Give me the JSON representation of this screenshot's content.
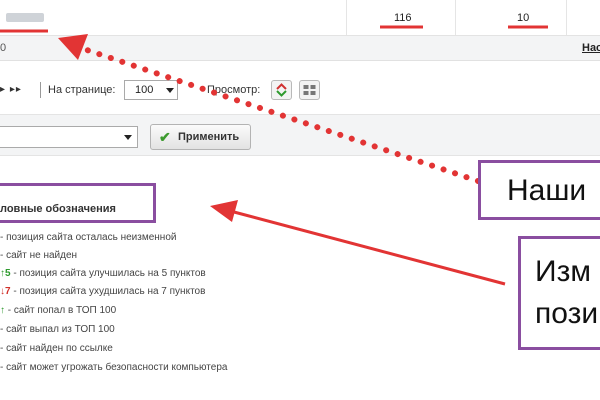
{
  "stats": {
    "value_1": "116",
    "value_2": "10"
  },
  "row2": {
    "left_fragment": "0",
    "settings_fragment": "Нас"
  },
  "toolbar": {
    "per_page_label": "На странице:",
    "per_page_value": "100",
    "view_label": "Просмотр:"
  },
  "filter": {
    "apply_label": "Применить"
  },
  "legend": {
    "title": "ловные обозначения",
    "items": [
      {
        "symbol": "",
        "text": "- позиция сайта осталась неизменной"
      },
      {
        "symbol": "",
        "text": "- сайт не найден"
      },
      {
        "symbol": "↑5",
        "text": " - позиция сайта улучшилась на 5 пунктов"
      },
      {
        "symbol": "↓7",
        "text": " - позиция сайта ухудшилась на 7 пунктов"
      },
      {
        "symbol": "↑",
        "text": " - сайт попал в ТОП 100"
      },
      {
        "symbol": "",
        "text": "- сайт выпал из ТОП 100"
      },
      {
        "symbol": "",
        "text": "- сайт найден по ссылке"
      },
      {
        "symbol": "",
        "text": "- сайт может угрожать безопасности компьютера"
      }
    ]
  },
  "callouts": {
    "first": "Наши",
    "second_line1": "Изм",
    "second_line2": "пози"
  },
  "colors": {
    "highlight_border": "#8a4ea0",
    "annotation_red": "#e23434",
    "up_green": "#2e9a2e",
    "down_red": "#d0302a"
  },
  "icons": [
    "play-next-icon",
    "last-page-icon",
    "up-down-arrows-icon",
    "grid-view-icon",
    "dropdown-arrow-icon",
    "checkmark-icon"
  ]
}
